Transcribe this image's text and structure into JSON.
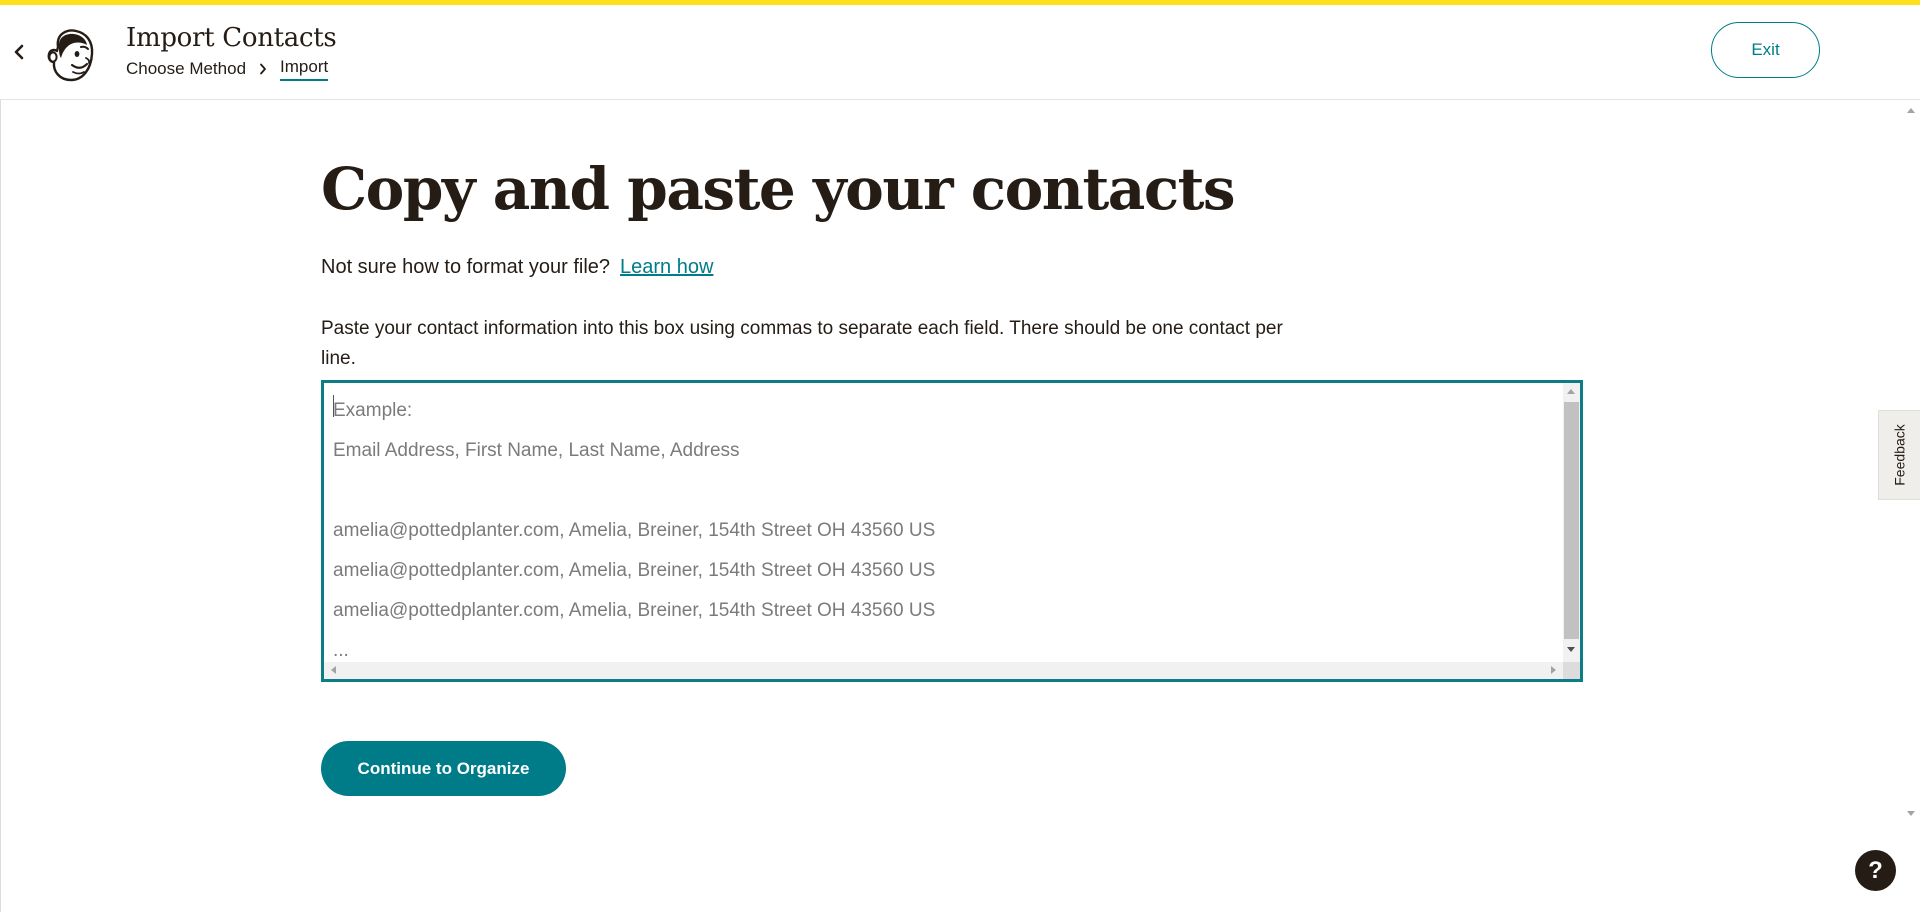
{
  "header": {
    "title": "Import Contacts",
    "breadcrumb": {
      "step1": "Choose Method",
      "step2": "Import"
    },
    "exit_label": "Exit"
  },
  "main": {
    "heading": "Copy and paste your contacts",
    "help_text": "Not sure how to format your file?",
    "help_link": "Learn how",
    "instructions": "Paste your contact information into this box using commas to separate each field. There should be one contact per line.",
    "paste_placeholder": "Example:\nEmail Address, First Name, Last Name, Address\n\namelia@pottedplanter.com, Amelia, Breiner, 154th Street OH 43560 US\namelia@pottedplanter.com, Amelia, Breiner, 154th Street OH 43560 US\namelia@pottedplanter.com, Amelia, Breiner, 154th Street OH 43560 US\n...",
    "paste_value": "",
    "continue_label": "Continue to Organize"
  },
  "side": {
    "feedback_label": "Feedback",
    "help_glyph": "?"
  },
  "icons": {
    "back": "chevron-left-icon",
    "logo": "mailchimp-freddie-logo",
    "breadcrumb_separator": "chevron-right-icon"
  },
  "colors": {
    "accent": "#007c89",
    "brand_yellow": "#ffe01b",
    "text": "#241c15"
  }
}
